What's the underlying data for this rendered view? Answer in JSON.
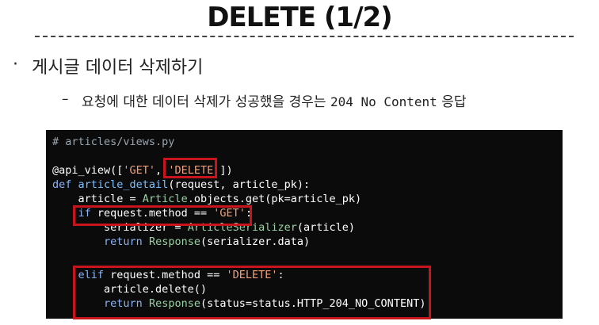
{
  "slide": {
    "title": "DELETE (1/2)",
    "bullet": "게시글 데이터 삭제하기",
    "sub_bullet_prefix": "요청에 대한 데이터 삭제가 성공했을 경우는 ",
    "sub_bullet_code": "204 No Content",
    "sub_bullet_suffix": " 응답"
  },
  "code": {
    "line1": "# articles/views.py",
    "line3_a": "@api_view([",
    "line3_b": "'GET'",
    "line3_c": ", ",
    "line3_d": "'DELETE'",
    "line3_e": "])",
    "line4_a": "def ",
    "line4_b": "article_detail",
    "line4_c": "(request, article_pk):",
    "line5_a": "    article = ",
    "line5_b": "Article",
    "line5_c": ".objects.get(pk=article_pk)",
    "line6_a": "    ",
    "line6_b": "if",
    "line6_c": " request.method == ",
    "line6_d": "'GET'",
    "line6_e": ":",
    "line7_a": "        serializer = ",
    "line7_b": "ArticleSerializer",
    "line7_c": "(article)",
    "line8_a": "        ",
    "line8_b": "return",
    "line8_c": " ",
    "line8_d": "Response",
    "line8_e": "(serializer.data)",
    "line10_a": "    ",
    "line10_b": "elif",
    "line10_c": " request.method == ",
    "line10_d": "'DELETE'",
    "line10_e": ":",
    "line11_a": "        article.delete()",
    "line12_a": "        ",
    "line12_b": "return",
    "line12_c": " ",
    "line12_d": "Response",
    "line12_e": "(status=status.HTTP_204_NO_CONTENT)"
  },
  "colors": {
    "highlight": "#c8141d",
    "code_background": "#0b0b0b"
  }
}
